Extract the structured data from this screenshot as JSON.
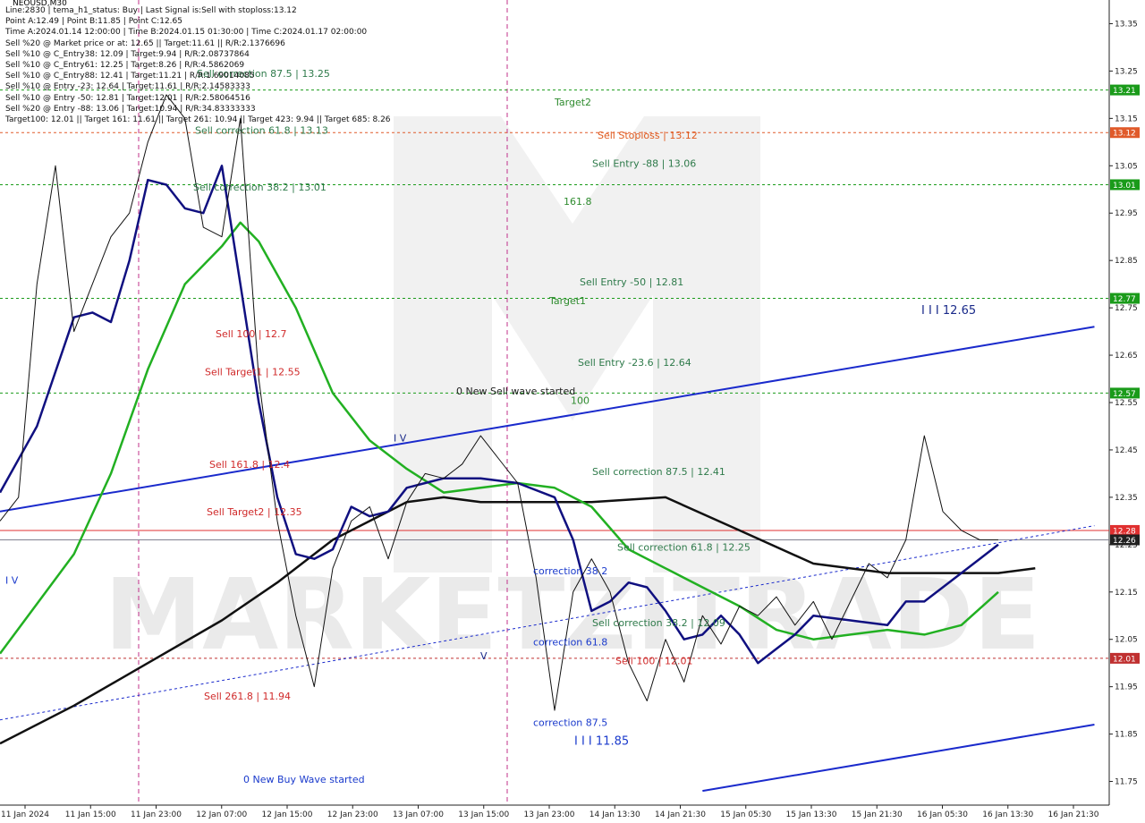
{
  "symbol_title": "NEOUSD,M30",
  "info_lines": [
    "Line:2830  |  tema_h1_status: Buy  |  Last Signal is:Sell with stoploss:13.12",
    "Point A:12.49  |  Point B:11.85  |  Point C:12.65",
    "Time A:2024.01.14 12:00:00  |  Time B:2024.01.15 01:30:00  |  Time C:2024.01.17 02:00:00",
    "Sell %20 @ Market price or at: 12.65  ||  Target:11.61  ||  R/R:2.1376696",
    "Sell %10 @ C_Entry38: 12.09  |  Target:9.94  |  R/R:2.08737864",
    "Sell %10 @ C_Entry61: 12.25  |  Target:8.26  |  R/R:4.5862069",
    "Sell %10 @ C_Entry88: 12.41  |  Target:11.21  |  R/R:1.69014085",
    "Sell %10 @ Entry -23: 12.64  |  Target:11.61  |  R/R:2.14583333",
    "Sell %10 @ Entry -50: 12.81  |  Target:12.01  |  R/R:2.58064516",
    "Sell %20 @ Entry -88: 13.06  |  Target:10.94  |  R/R:34.83333333",
    "Target100: 12.01  ||  Target 161: 11.61  ||  Target 261: 10.94  ||  Target 423: 9.94  ||  Target 685: 8.26"
  ],
  "watermark": "MARKETZITRADE",
  "price_labels": [
    {
      "price": 13.21,
      "text": "13.21",
      "color": "#1a9b1a"
    },
    {
      "price": 13.12,
      "text": "13.12",
      "color": "#e05a2a"
    },
    {
      "price": 13.01,
      "text": "13.01",
      "color": "#1a9b1a"
    },
    {
      "price": 12.77,
      "text": "12.77",
      "color": "#1a9b1a"
    },
    {
      "price": 12.57,
      "text": "12.57",
      "color": "#1a9b1a"
    },
    {
      "price": 12.28,
      "text": "12.28",
      "color": "#e03030"
    },
    {
      "price": 12.26,
      "text": "12.26",
      "color": "#202020"
    },
    {
      "price": 12.01,
      "text": "12.01",
      "color": "#c03030"
    }
  ],
  "chart_annotations": [
    {
      "text": "Target2",
      "price": 13.185,
      "color": "#2e8b2e"
    },
    {
      "text": "Sell Stoploss | 13.12",
      "price": 13.115,
      "color": "#e05a1e"
    },
    {
      "text": "Sell Entry -88 | 13.06",
      "price": 13.055,
      "color": "#2e7a4a"
    },
    {
      "text": "161.8",
      "price": 12.975,
      "color": "#2e8b2e"
    },
    {
      "text": "Sell Entry -50 | 12.81",
      "price": 12.805,
      "color": "#2e7a4a"
    },
    {
      "text": "Target1",
      "price": 12.765,
      "color": "#2e8b2e"
    },
    {
      "text": "Sell Entry -23.6 | 12.64",
      "price": 12.635,
      "color": "#2e7a4a"
    },
    {
      "text": "100",
      "price": 12.555,
      "color": "#2e8b2e"
    },
    {
      "text": "0 New Sell wave started",
      "price": 12.575,
      "color": "#222222"
    },
    {
      "text": "Sell correction 87.5 | 12.41",
      "price": 12.405,
      "color": "#2e7a4a"
    },
    {
      "text": "Sell correction 61.8 | 12.25",
      "price": 12.245,
      "color": "#2e7a4a"
    },
    {
      "text": "Sell correction 38.2 | 12.09",
      "price": 12.085,
      "color": "#2e7a4a"
    },
    {
      "text": "Sell 100 | 12.01",
      "price": 12.005,
      "color": "#d02a2a"
    },
    {
      "text": "correction 38.2",
      "price": 12.195,
      "color": "#1a3acc"
    },
    {
      "text": "correction 61.8",
      "price": 12.045,
      "color": "#1a3acc"
    },
    {
      "text": "correction 87.5",
      "price": 11.875,
      "color": "#1a3acc"
    },
    {
      "text": "I I I 11.85",
      "price": 11.835,
      "color": "#1a3acc"
    },
    {
      "text": "I I I 12.65",
      "price": 12.745,
      "color": "#1a2a8a"
    },
    {
      "text": "0 New Buy Wave started",
      "price": 11.755,
      "color": "#1a3acc"
    },
    {
      "text": "Sell 100 | 12.7",
      "price": 12.695,
      "color": "#d02a2a"
    },
    {
      "text": "Sell Target1 | 12.55",
      "price": 12.615,
      "color": "#d02a2a"
    },
    {
      "text": "Sell 161.8 | 12.4",
      "price": 12.42,
      "color": "#d02a2a"
    },
    {
      "text": "Sell Target2 | 12.35",
      "price": 12.32,
      "color": "#d02a2a"
    },
    {
      "text": "Sell 261.8 | 11.94",
      "price": 11.93,
      "color": "#d02a2a"
    },
    {
      "text": "Sell correction 38.2 | 13.01",
      "price": 13.005,
      "color": "#2e7a4a"
    },
    {
      "text": "Sell correction 61.8 | 13.13",
      "price": 13.125,
      "color": "#2e7a4a"
    },
    {
      "text": "Sell correction 87.5 | 13.25",
      "price": 13.245,
      "color": "#2e7a4a"
    },
    {
      "text": "I V",
      "price": 12.475,
      "color": "#1a2a8a"
    },
    {
      "text": "V",
      "price": 12.015,
      "color": "#1a2a8a"
    },
    {
      "text": "I V",
      "price": 12.175,
      "color": "#1a3acc"
    }
  ],
  "chart_data": {
    "type": "line",
    "ylim": [
      11.7,
      13.4
    ],
    "y_ticks": [
      13.35,
      13.25,
      13.15,
      13.05,
      12.95,
      12.85,
      12.75,
      12.65,
      12.55,
      12.45,
      12.35,
      12.25,
      12.15,
      12.05,
      11.95,
      11.85,
      11.75
    ],
    "x_tick_labels": [
      "11 Jan 2024",
      "11 Jan 15:00",
      "11 Jan 23:00",
      "12 Jan 07:00",
      "12 Jan 15:00",
      "12 Jan 23:00",
      "13 Jan 07:00",
      "13 Jan 15:00",
      "13 Jan 23:00",
      "14 Jan 13:30",
      "14 Jan 21:30",
      "15 Jan 05:30",
      "15 Jan 13:30",
      "15 Jan 21:30",
      "16 Jan 05:30",
      "16 Jan 13:30",
      "16 Jan 21:30"
    ],
    "x_bars_range": [
      0,
      300
    ],
    "horizontal_levels": [
      {
        "price": 13.21,
        "color": "#1a9b1a",
        "style": "dashed"
      },
      {
        "price": 13.12,
        "color": "#e05a2a",
        "style": "dashed"
      },
      {
        "price": 13.01,
        "color": "#1a9b1a",
        "style": "dashed"
      },
      {
        "price": 12.77,
        "color": "#1a9b1a",
        "style": "dashed"
      },
      {
        "price": 12.57,
        "color": "#1a9b1a",
        "style": "dashed"
      },
      {
        "price": 12.28,
        "color": "#e03030",
        "style": "solid"
      },
      {
        "price": 12.26,
        "color": "#808090",
        "style": "solid"
      },
      {
        "price": 12.01,
        "color": "#c03030",
        "style": "dashed"
      }
    ],
    "trend_lines": [
      {
        "x": [
          0,
          296
        ],
        "y": [
          12.32,
          12.71
        ],
        "color": "#1a2acc",
        "width": 2,
        "dash": false
      },
      {
        "x": [
          190,
          296
        ],
        "y": [
          11.73,
          11.87
        ],
        "color": "#1a2acc",
        "width": 2,
        "dash": false
      },
      {
        "x": [
          0,
          296
        ],
        "y": [
          11.88,
          12.29
        ],
        "color": "#1a2acc",
        "width": 1,
        "dash": true
      }
    ],
    "series": [
      {
        "name": "black",
        "color": "#111111",
        "width": 2.5,
        "x": [
          0,
          20,
          40,
          60,
          75,
          90,
          100,
          110,
          120,
          130,
          140,
          160,
          180,
          200,
          220,
          240,
          260,
          270,
          280
        ],
        "y": [
          11.83,
          11.91,
          12.0,
          12.09,
          12.17,
          12.26,
          12.3,
          12.34,
          12.35,
          12.34,
          12.34,
          12.34,
          12.35,
          12.28,
          12.21,
          12.19,
          12.19,
          12.19,
          12.2
        ]
      },
      {
        "name": "green",
        "color": "#22b022",
        "width": 2.5,
        "x": [
          0,
          20,
          30,
          40,
          50,
          60,
          65,
          70,
          80,
          90,
          100,
          110,
          120,
          130,
          140,
          150,
          160,
          170,
          180,
          190,
          200,
          210,
          220,
          230,
          240,
          250,
          260,
          270
        ],
        "y": [
          12.02,
          12.23,
          12.4,
          12.62,
          12.8,
          12.88,
          12.93,
          12.89,
          12.75,
          12.57,
          12.47,
          12.41,
          12.36,
          12.37,
          12.38,
          12.37,
          12.33,
          12.24,
          12.2,
          12.16,
          12.12,
          12.07,
          12.05,
          12.06,
          12.07,
          12.06,
          12.08,
          12.15
        ]
      },
      {
        "name": "navy",
        "color": "#101080",
        "width": 2.5,
        "x": [
          0,
          10,
          20,
          25,
          30,
          35,
          40,
          45,
          50,
          55,
          60,
          65,
          70,
          75,
          80,
          85,
          90,
          95,
          100,
          105,
          110,
          115,
          120,
          130,
          140,
          150,
          155,
          160,
          165,
          170,
          175,
          180,
          185,
          190,
          195,
          200,
          205,
          210,
          215,
          220,
          230,
          240,
          245,
          250,
          255,
          260,
          265,
          270
        ],
        "y": [
          12.36,
          12.5,
          12.73,
          12.74,
          12.72,
          12.85,
          13.02,
          13.01,
          12.96,
          12.95,
          13.05,
          12.8,
          12.55,
          12.35,
          12.23,
          12.22,
          12.24,
          12.33,
          12.31,
          12.32,
          12.37,
          12.38,
          12.39,
          12.39,
          12.38,
          12.35,
          12.26,
          12.11,
          12.13,
          12.17,
          12.16,
          12.11,
          12.05,
          12.06,
          12.1,
          12.06,
          12.0,
          12.03,
          12.06,
          12.1,
          12.09,
          12.08,
          12.13,
          12.13,
          12.16,
          12.19,
          12.22,
          12.25
        ]
      },
      {
        "name": "price",
        "color": "#111111",
        "width": 1,
        "x": [
          0,
          5,
          10,
          15,
          20,
          25,
          30,
          35,
          40,
          45,
          50,
          55,
          60,
          65,
          70,
          75,
          80,
          85,
          90,
          95,
          100,
          105,
          110,
          115,
          120,
          125,
          130,
          135,
          140,
          145,
          150,
          155,
          160,
          165,
          170,
          175,
          180,
          185,
          190,
          195,
          200,
          205,
          210,
          215,
          220,
          225,
          230,
          235,
          240,
          245,
          250,
          255,
          260,
          265,
          270
        ],
        "y": [
          12.3,
          12.35,
          12.8,
          13.05,
          12.7,
          12.8,
          12.9,
          12.95,
          13.1,
          13.2,
          13.15,
          12.92,
          12.9,
          13.15,
          12.6,
          12.3,
          12.1,
          11.95,
          12.2,
          12.3,
          12.33,
          12.22,
          12.34,
          12.4,
          12.39,
          12.42,
          12.48,
          12.43,
          12.38,
          12.18,
          11.9,
          12.15,
          12.22,
          12.15,
          12.0,
          11.92,
          12.05,
          11.96,
          12.1,
          12.04,
          12.12,
          12.1,
          12.14,
          12.08,
          12.13,
          12.05,
          12.13,
          12.21,
          12.18,
          12.26,
          12.48,
          12.32,
          12.28,
          12.26,
          12.26
        ]
      }
    ]
  }
}
